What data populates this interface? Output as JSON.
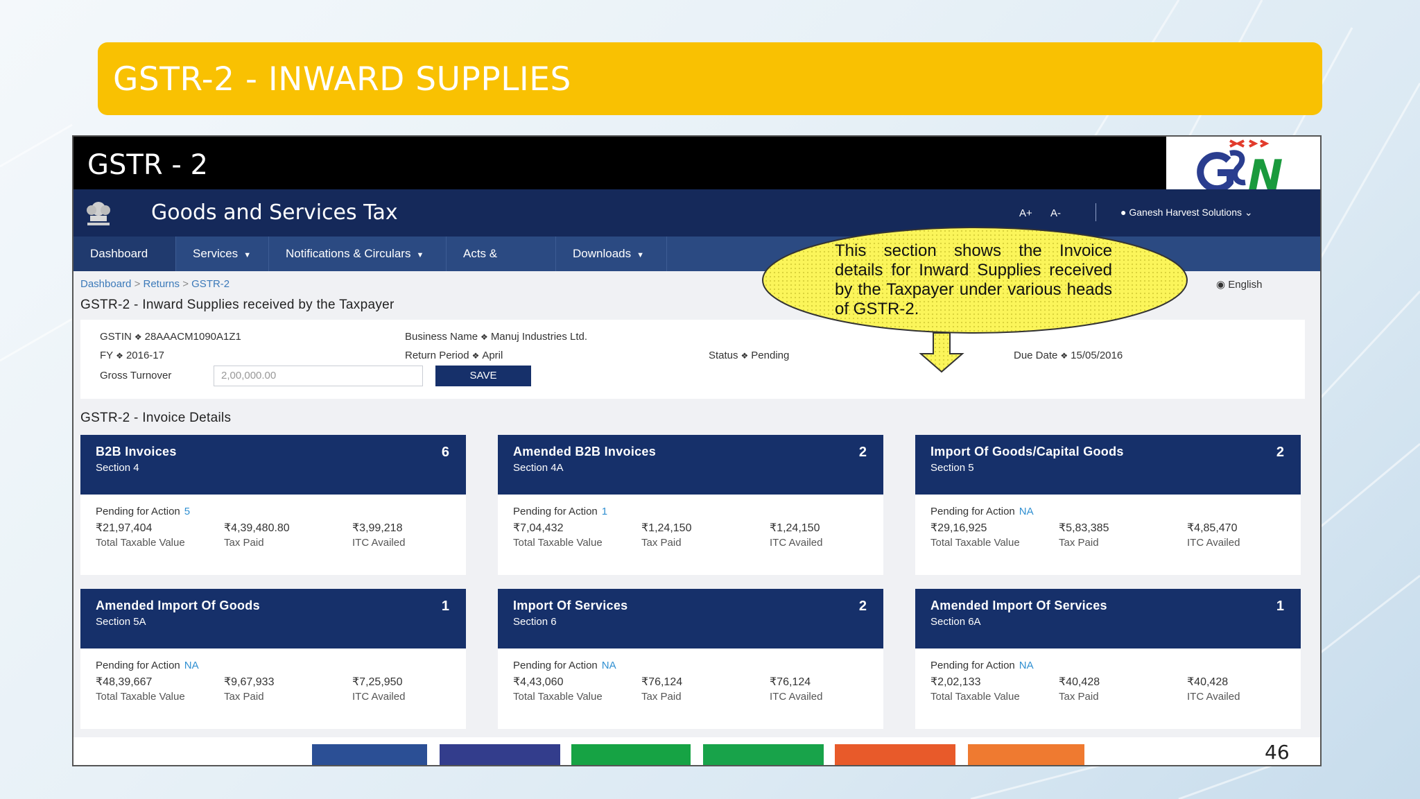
{
  "slide": {
    "title": "GSTR-2 - INWARD SUPPLIES",
    "page_number": "46"
  },
  "window": {
    "title": "GSTR - 2"
  },
  "header": {
    "brand": "Goods and Services Tax",
    "font_increase": "A+",
    "font_decrease": "A-",
    "user_name": "Ganesh Harvest Solutions"
  },
  "nav": {
    "items": [
      {
        "label": "Dashboard"
      },
      {
        "label": "Services"
      },
      {
        "label": "Notifications & Circulars"
      },
      {
        "label": "Acts & Rules"
      },
      {
        "label": "Downloads"
      }
    ]
  },
  "breadcrumb": {
    "items": [
      "Dashboard",
      "Returns",
      "GSTR-2"
    ]
  },
  "language": "English",
  "page_heading": "GSTR-2 - Inward Supplies received by the Taxpayer",
  "info": {
    "gstin_label": "GSTIN",
    "gstin_value": "28AAACM1090A1Z1",
    "business_label": "Business Name",
    "business_value": "Manuj Industries Ltd.",
    "fy_label": "FY",
    "fy_value": "2016-17",
    "period_label": "Return Period",
    "period_value": "April",
    "status_label": "Status",
    "status_value": "Pending",
    "due_label": "Due Date",
    "due_value": "15/05/2016",
    "turnover_label": "Gross Turnover",
    "turnover_value": "2,00,000.00",
    "save_label": "SAVE"
  },
  "invoice_heading": "GSTR-2 - Invoice Details",
  "cards": [
    {
      "title": "B2B Invoices",
      "section": "Section 4",
      "count": "6",
      "pending_label": "Pending for Action",
      "pending_value": "5",
      "taxable": "₹21,97,404",
      "tax_paid": "₹4,39,480.80",
      "itc": "₹3,99,218",
      "taxable_label": "Total Taxable Value",
      "tax_label": "Tax Paid",
      "itc_label": "ITC Availed"
    },
    {
      "title": "Amended B2B Invoices",
      "section": "Section 4A",
      "count": "2",
      "pending_label": "Pending for Action",
      "pending_value": "1",
      "taxable": "₹7,04,432",
      "tax_paid": "₹1,24,150",
      "itc": "₹1,24,150",
      "taxable_label": "Total Taxable Value",
      "tax_label": "Tax Paid",
      "itc_label": "ITC Availed"
    },
    {
      "title": "Import Of Goods/Capital Goods",
      "section": "Section 5",
      "count": "2",
      "pending_label": "Pending for Action",
      "pending_value": "NA",
      "taxable": "₹29,16,925",
      "tax_paid": "₹5,83,385",
      "itc": "₹4,85,470",
      "taxable_label": "Total Taxable Value",
      "tax_label": "Tax Paid",
      "itc_label": "ITC Availed"
    },
    {
      "title": "Amended Import Of Goods",
      "section": "Section 5A",
      "count": "1",
      "pending_label": "Pending for Action",
      "pending_value": "NA",
      "taxable": "₹48,39,667",
      "tax_paid": "₹9,67,933",
      "itc": "₹7,25,950",
      "taxable_label": "Total Taxable Value",
      "tax_label": "Tax Paid",
      "itc_label": "ITC Availed"
    },
    {
      "title": "Import Of Services",
      "section": "Section 6",
      "count": "2",
      "pending_label": "Pending for Action",
      "pending_value": "NA",
      "taxable": "₹4,43,060",
      "tax_paid": "₹76,124",
      "itc": "₹76,124",
      "taxable_label": "Total Taxable Value",
      "tax_label": "Tax Paid",
      "itc_label": "ITC Availed"
    },
    {
      "title": "Amended Import Of Services",
      "section": "Section 6A",
      "count": "1",
      "pending_label": "Pending for Action",
      "pending_value": "NA",
      "taxable": "₹2,02,133",
      "tax_paid": "₹40,428",
      "itc": "₹40,428",
      "taxable_label": "Total Taxable Value",
      "tax_label": "Tax Paid",
      "itc_label": "ITC Availed"
    }
  ],
  "callout": {
    "text": "This section shows the Invoice details for Inward Supplies received by the Taxpayer under various heads of GSTR-2."
  },
  "logo": {
    "letters": "GSTN"
  },
  "colors": {
    "title_bar": "#f9c102",
    "header_bg": "#15295a",
    "nav_bg": "#2b4a82",
    "card_header": "#16306a",
    "stripes": [
      "#2b4f95",
      "#333d8c",
      "#16a344",
      "#18a34a",
      "#e85a2a",
      "#ef7a30"
    ]
  }
}
